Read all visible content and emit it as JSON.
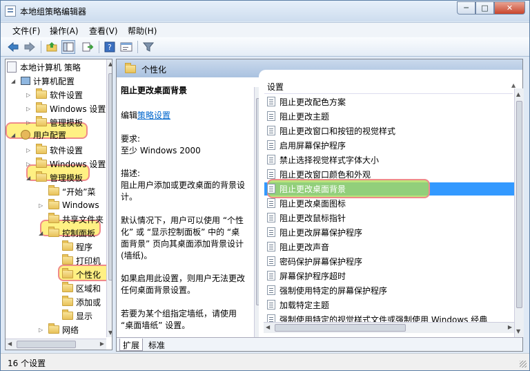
{
  "window": {
    "title": "本地组策略编辑器",
    "minimize": "─",
    "maximize": "□",
    "close": "✕"
  },
  "menu": {
    "items": [
      "文件(F)",
      "操作(A)",
      "查看(V)",
      "帮助(H)"
    ]
  },
  "toolbar": {
    "icons": [
      "back-arrow-icon",
      "forward-arrow-icon",
      "up-folder-icon",
      "show-hide-tree-icon",
      "export-list-icon",
      "help-icon",
      "properties-icon",
      "filter-icon"
    ]
  },
  "tree": {
    "items": [
      {
        "label": "本地计算机 策略",
        "icon": "policy-doc-icon"
      },
      {
        "label": "计算机配置",
        "icon": "computer-icon"
      },
      {
        "label": "软件设置",
        "icon": "folder-icon"
      },
      {
        "label": "Windows 设置",
        "icon": "folder-icon"
      },
      {
        "label": "管理模板",
        "icon": "folder-icon"
      },
      {
        "label": "用户配置",
        "icon": "user-icon"
      },
      {
        "label": "软件设置",
        "icon": "folder-icon"
      },
      {
        "label": "Windows 设置",
        "icon": "folder-icon"
      },
      {
        "label": "管理模板",
        "icon": "folder-icon"
      },
      {
        "label": "“开始”菜",
        "icon": "folder-icon"
      },
      {
        "label": "Windows",
        "icon": "folder-icon"
      },
      {
        "label": "共享文件夹",
        "icon": "folder-icon"
      },
      {
        "label": "控制面板",
        "icon": "folder-icon"
      },
      {
        "label": "程序",
        "icon": "folder-icon"
      },
      {
        "label": "打印机",
        "icon": "folder-icon"
      },
      {
        "label": "个性化",
        "icon": "folder-icon"
      },
      {
        "label": "区域和",
        "icon": "folder-icon"
      },
      {
        "label": "添加或",
        "icon": "folder-icon"
      },
      {
        "label": "显示",
        "icon": "folder-icon"
      },
      {
        "label": "网络",
        "icon": "folder-icon"
      }
    ]
  },
  "panel": {
    "header": "个性化"
  },
  "description": {
    "title": "阻止更改桌面背景",
    "edit_prefix": "编辑",
    "edit_link": "策略设置",
    "req_label": "要求:",
    "req_value": "至少 Windows 2000",
    "desc_label": "描述:",
    "desc_line1": "阻止用户添加或更改桌面的背景设",
    "desc_line2": "计。",
    "para2_line1": "默认情况下，用户可以使用 “个性",
    "para2_line2": "化” 或 “显示控制面板” 中的 “桌",
    "para2_line3": "面背景” 页向其桌面添加背景设计",
    "para2_line4": "(墙纸)。",
    "para3_line1": "如果启用此设置，则用户无法更改",
    "para3_line2": "任何桌面背景设置。",
    "para4_line1": "若要为某个组指定墙纸，请使用",
    "para4_line2": "“桌面墙纸” 设置。"
  },
  "settings": {
    "column_header": "设置",
    "items": [
      "阻止更改配色方案",
      "阻止更改主题",
      "阻止更改窗口和按钮的视觉样式",
      "启用屏幕保护程序",
      "禁止选择视觉样式字体大小",
      "阻止更改窗口颜色和外观",
      "阻止更改桌面背景",
      "阻止更改桌面图标",
      "阻止更改鼠标指针",
      "阻止更改屏幕保护程序",
      "阻止更改声音",
      "密码保护屏幕保护程序",
      "屏幕保护程序超时",
      "强制使用特定的屏幕保护程序",
      "加载特定主题",
      "强制使用特定的视觉样式文件或强制使用 Windows 经典"
    ],
    "selected_index": 6
  },
  "tabs": {
    "extended": "扩展",
    "standard": "标准"
  },
  "status": {
    "text": "16 个设置"
  },
  "colors": {
    "selection": "#3399ff",
    "highlight_yellow": "#ffeb5a",
    "highlight_green": "#aadc5a",
    "highlight_border": "#ef8a8a",
    "link": "#0066cc"
  }
}
